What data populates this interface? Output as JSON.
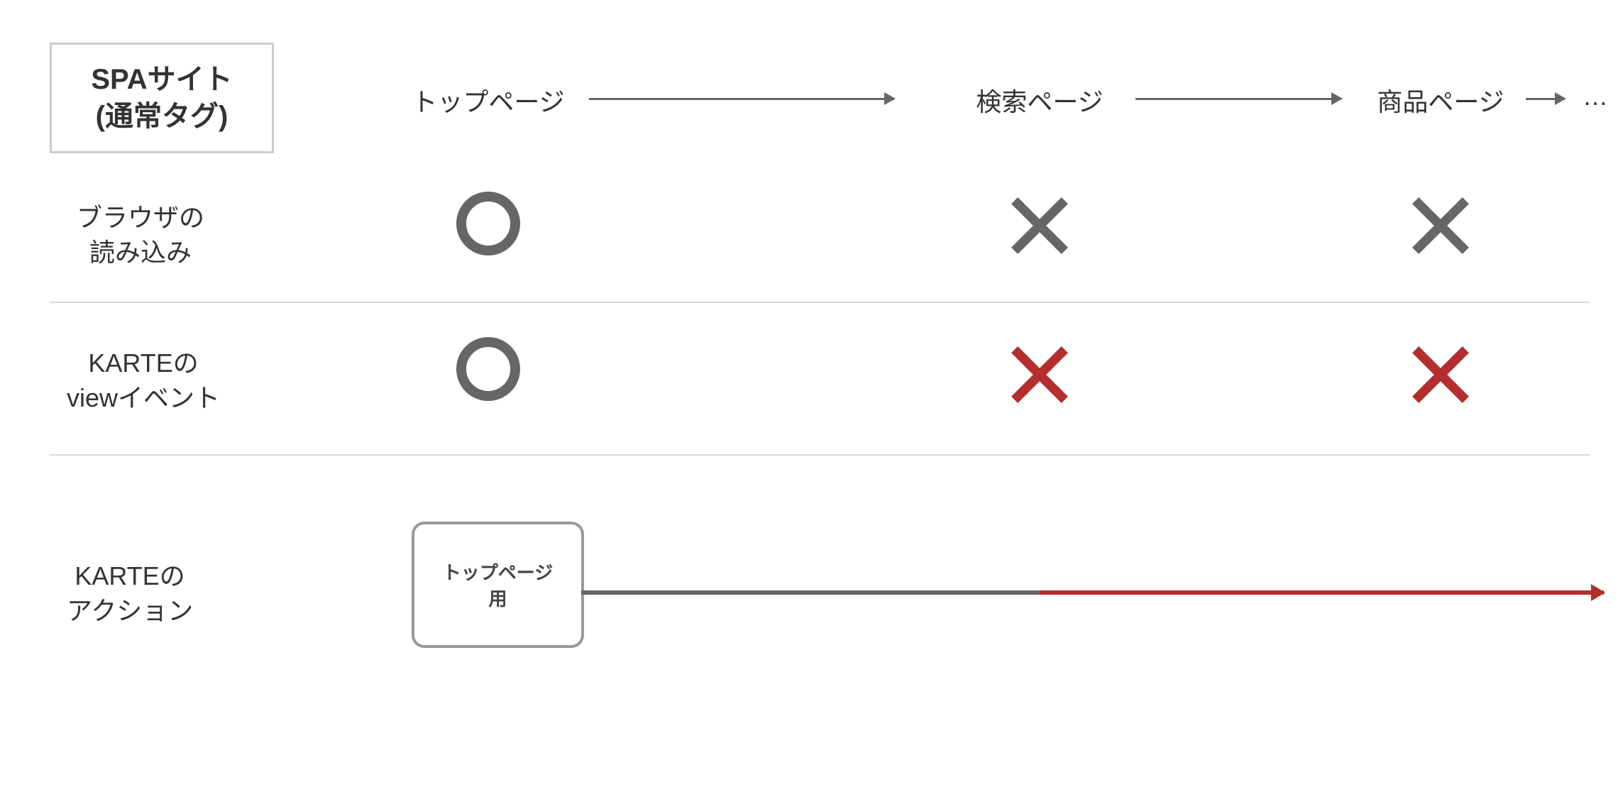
{
  "header": {
    "line1": "SPAサイト",
    "line2": "(通常タグ)"
  },
  "pages": {
    "top": "トップページ",
    "search": "検索ページ",
    "product": "商品ページ",
    "ellipsis": "…"
  },
  "rows": {
    "browser": {
      "line1": "ブラウザの",
      "line2": "読み込み"
    },
    "view_event": {
      "line1": "KARTEの",
      "line2": "viewイベント"
    },
    "action": {
      "line1": "KARTEの",
      "line2": "アクション"
    }
  },
  "action_box": {
    "line1": "トップページ",
    "line2": "用"
  },
  "marks": {
    "browser": [
      "circle",
      "x-gray",
      "x-gray"
    ],
    "view_event": [
      "circle",
      "x-red",
      "x-red"
    ]
  }
}
